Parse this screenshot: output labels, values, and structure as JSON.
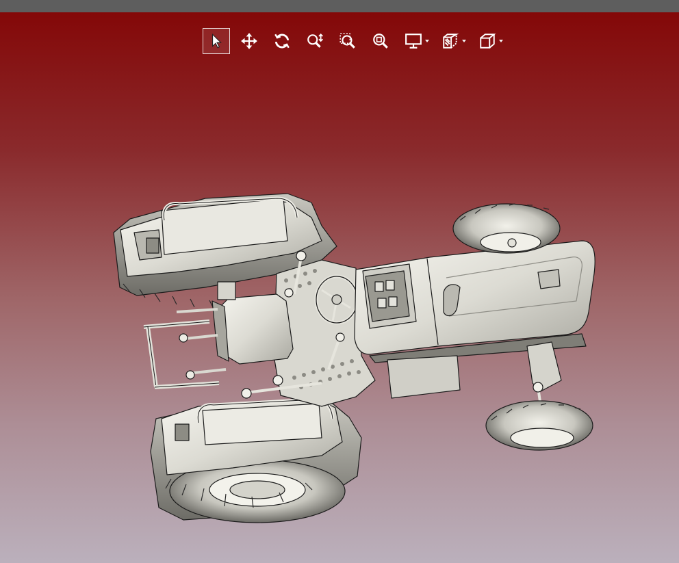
{
  "window": {
    "title_bar_color": "#5e5e5e"
  },
  "viewport": {
    "background_gradient": [
      "#840808",
      "#8a2a2c",
      "#9f6668",
      "#ad8e96",
      "#bbb0bc"
    ],
    "model_color": "#e4e3dc"
  },
  "toolbar": {
    "active_tool": "select",
    "buttons": [
      {
        "id": "select",
        "icon": "pointer-icon",
        "has_dropdown": false
      },
      {
        "id": "pan",
        "icon": "move-arrows-icon",
        "has_dropdown": false
      },
      {
        "id": "rotate",
        "icon": "rotate-icon",
        "has_dropdown": false
      },
      {
        "id": "zoom-dynamic",
        "icon": "zoom-updown-icon",
        "has_dropdown": false
      },
      {
        "id": "zoom-window",
        "icon": "zoom-window-icon",
        "has_dropdown": false
      },
      {
        "id": "zoom-fit",
        "icon": "zoom-fit-icon",
        "has_dropdown": false
      },
      {
        "id": "display-mode",
        "icon": "monitor-icon",
        "has_dropdown": true
      },
      {
        "id": "section-view",
        "icon": "section-view-icon",
        "has_dropdown": true
      },
      {
        "id": "view-orientation",
        "icon": "cube-icon",
        "has_dropdown": true
      }
    ]
  }
}
